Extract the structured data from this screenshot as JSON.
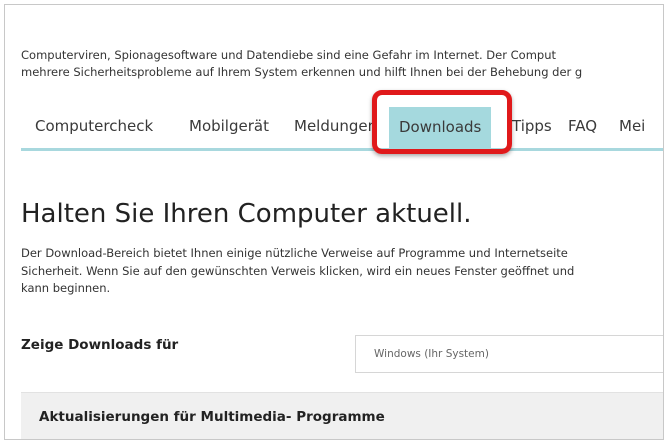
{
  "intro": {
    "line1": "Computerviren, Spionagesoftware und Datendiebe sind eine Gefahr im Internet. Der Comput",
    "line2": "mehrere Sicherheitsprobleme auf Ihrem System erkennen und hilft Ihnen bei der Behebung der g"
  },
  "nav": {
    "items": [
      {
        "label": "Computercheck"
      },
      {
        "label": "Mobilgerät"
      },
      {
        "label": "Meldungen"
      },
      {
        "label": "Downloads"
      },
      {
        "label": "Tipps"
      },
      {
        "label": "FAQ"
      },
      {
        "label": "Mei"
      }
    ],
    "active_index": 3
  },
  "main": {
    "heading": "Halten Sie Ihren Computer aktuell.",
    "desc_line1": "Der Download-Bereich bietet Ihnen einige nützliche Verweise auf Programme und Internetseite",
    "desc_line2": "Sicherheit. Wenn Sie auf den gewünschten Verweis klicken, wird ein neues Fenster geöffnet und",
    "desc_line3": "kann beginnen."
  },
  "filter": {
    "label": "Zeige Downloads für",
    "selected": "Windows (Ihr System)"
  },
  "accordion": {
    "title": "Aktualisierungen für Multimedia- Programme"
  },
  "colors": {
    "active_tab_bg": "#a5d9de",
    "nav_underline": "#a8d8de",
    "highlight_border": "#e0191b"
  }
}
